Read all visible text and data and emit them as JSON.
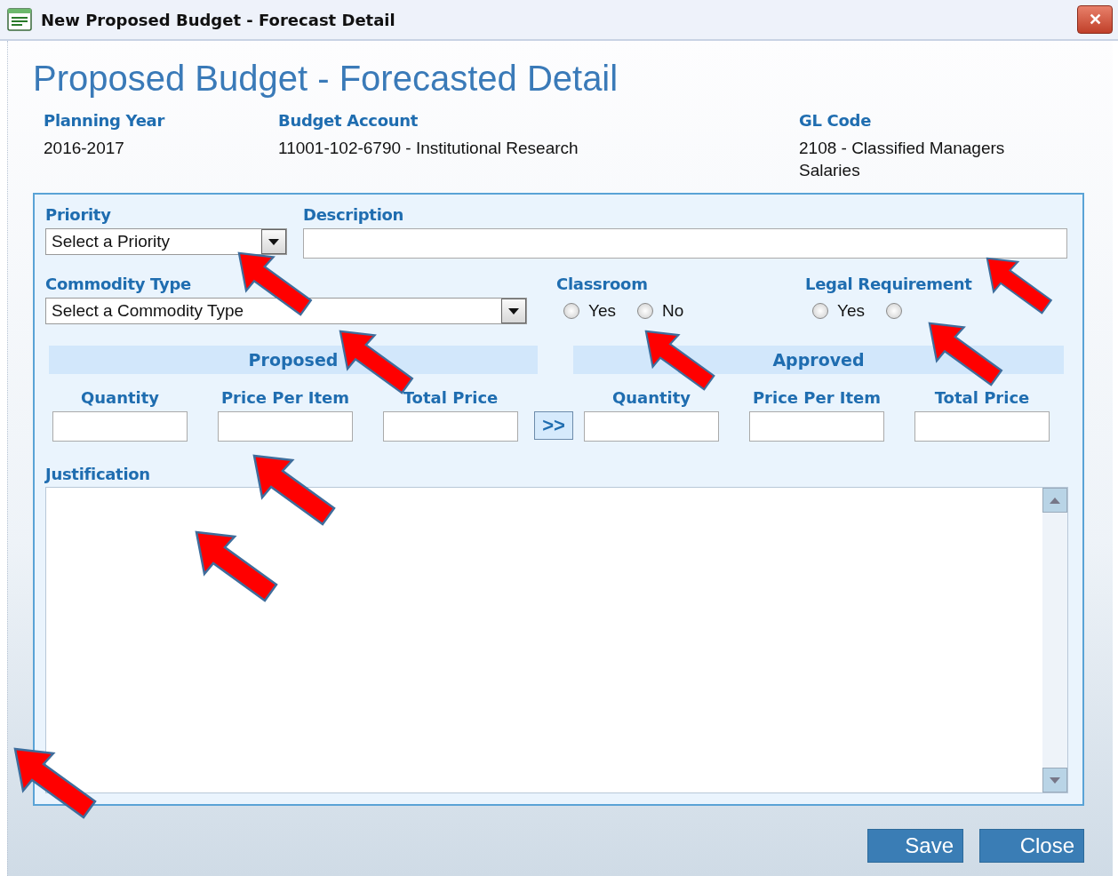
{
  "window": {
    "title": "New Proposed Budget - Forecast Detail",
    "close": "✕"
  },
  "heading": "Proposed Budget - Forecasted Detail",
  "info": [
    {
      "label": "Planning Year",
      "value": "2016-2017"
    },
    {
      "label": "Budget Account",
      "value": "11001-102-6790 - Institutional Research"
    },
    {
      "label": "GL Code",
      "value": "2108 - Classified Managers Salaries"
    }
  ],
  "priority": {
    "label": "Priority",
    "placeholder": "Select a Priority"
  },
  "description": {
    "label": "Description"
  },
  "commodity_type": {
    "label": "Commodity Type",
    "placeholder": "Select a Commodity Type"
  },
  "classroom": {
    "label": "Classroom",
    "options": [
      {
        "label": "Yes",
        "selected": false
      },
      {
        "label": "No",
        "selected": false
      }
    ]
  },
  "legal_requirement": {
    "label": "Legal Requirement",
    "options": [
      {
        "label": "Yes",
        "selected": false
      },
      {
        "selected": false
      }
    ]
  },
  "proposed": {
    "title": "Proposed",
    "columns": [
      "Quantity",
      "Price Per Item",
      "Total Price"
    ]
  },
  "copy_button": ">>",
  "approved": {
    "title": "Approved",
    "columns": [
      "Quantity",
      "Price Per Item",
      "Total Price"
    ]
  },
  "justification": {
    "label": "Justification"
  },
  "buttons": [
    "Save",
    "Close"
  ]
}
